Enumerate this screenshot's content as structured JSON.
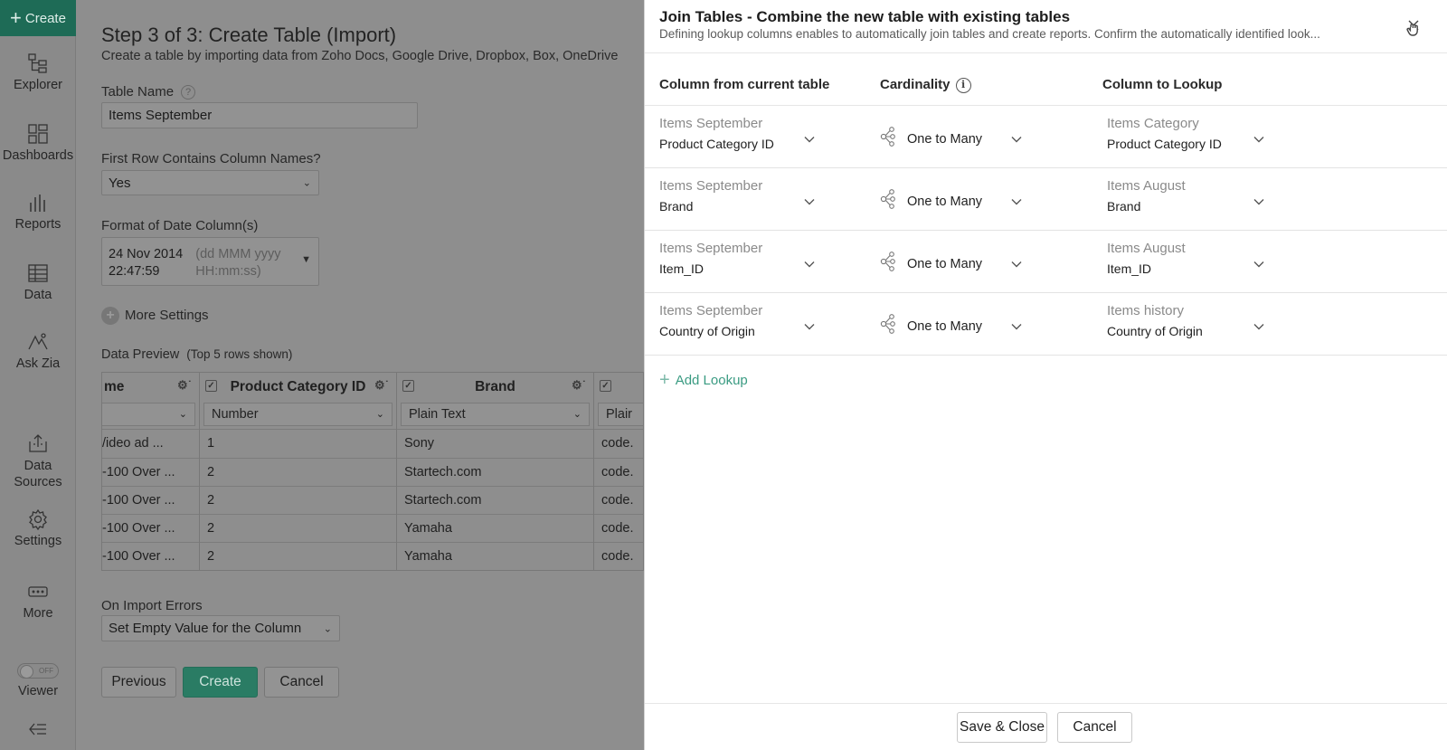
{
  "nav": {
    "create_label": "Create",
    "items": [
      {
        "label": "Explorer",
        "icon": "explorer-icon"
      },
      {
        "label": "Dashboards",
        "icon": "dashboards-icon"
      },
      {
        "label": "Reports",
        "icon": "reports-icon"
      },
      {
        "label": "Data",
        "icon": "data-icon"
      },
      {
        "label": "Ask Zia",
        "icon": "ask-zia-icon"
      },
      {
        "label": "Data Sources",
        "icon": "data-sources-icon"
      },
      {
        "label": "Settings",
        "icon": "settings-icon"
      },
      {
        "label": "More",
        "icon": "more-icon"
      },
      {
        "label": "Viewer",
        "icon": "toggle-icon"
      }
    ],
    "viewer_toggle": "OFF",
    "collapse_icon": "collapse-icon"
  },
  "form": {
    "title": "Step 3 of 3: Create Table (Import)",
    "subtitle": "Create a table by importing data from Zoho Docs, Google Drive, Dropbox, Box, OneDrive",
    "table_name_label": "Table Name",
    "table_name_value": "Items September",
    "first_row_label": "First Row Contains Column Names?",
    "first_row_value": "Yes",
    "date_format_label": "Format of Date Column(s)",
    "date_sample_line1": "24 Nov 2014",
    "date_sample_line2": "22:47:59",
    "date_pattern_line1": "(dd MMM yyyy",
    "date_pattern_line2": "HH:mm:ss)",
    "more_settings": "More Settings",
    "preview_label": "Data Preview",
    "preview_note": "(Top 5 rows shown)",
    "columns": [
      {
        "header": "me",
        "type": "",
        "cells": [
          "/ideo ad ...",
          "-100 Over ...",
          "-100 Over ...",
          "-100 Over ...",
          "-100 Over ..."
        ]
      },
      {
        "header": "Product Category ID",
        "type": "Number",
        "cells": [
          "1",
          "2",
          "2",
          "2",
          "2"
        ]
      },
      {
        "header": "Brand",
        "type": "Plain Text",
        "cells": [
          "Sony",
          "Startech.com",
          "Startech.com",
          "Yamaha",
          "Yamaha"
        ]
      },
      {
        "header": "",
        "type": "Plair",
        "cells": [
          "code.",
          "code.",
          "code.",
          "code.",
          "code."
        ]
      }
    ],
    "import_errors_label": "On Import Errors",
    "import_errors_value": "Set Empty Value for the Column",
    "previous_label": "Previous",
    "create_label": "Create",
    "cancel_label": "Cancel"
  },
  "panel": {
    "title": "Join Tables - Combine the new table with existing tables",
    "subtitle": "Defining lookup columns enables to automatically join tables and create reports. Confirm the automatically identified look...",
    "head_current": "Column from current table",
    "head_cardinality": "Cardinality",
    "head_lookup": "Column to Lookup",
    "rows": [
      {
        "src_table": "Items September",
        "src_col": "Product Category ID",
        "cardinality": "One to Many",
        "dst_table": "Items Category",
        "dst_col": "Product Category ID"
      },
      {
        "src_table": "Items September",
        "src_col": "Brand",
        "cardinality": "One to Many",
        "dst_table": "Items August",
        "dst_col": "Brand"
      },
      {
        "src_table": "Items September",
        "src_col": "Item_ID",
        "cardinality": "One to Many",
        "dst_table": "Items August",
        "dst_col": "Item_ID"
      },
      {
        "src_table": "Items September",
        "src_col": "Country of Origin",
        "cardinality": "One to Many",
        "dst_table": "Items history",
        "dst_col": "Country of Origin"
      }
    ],
    "add_lookup": "Add Lookup",
    "save_close": "Save & Close",
    "cancel": "Cancel"
  },
  "colors": {
    "accent": "#2a7c64",
    "link": "#3a9b82"
  }
}
